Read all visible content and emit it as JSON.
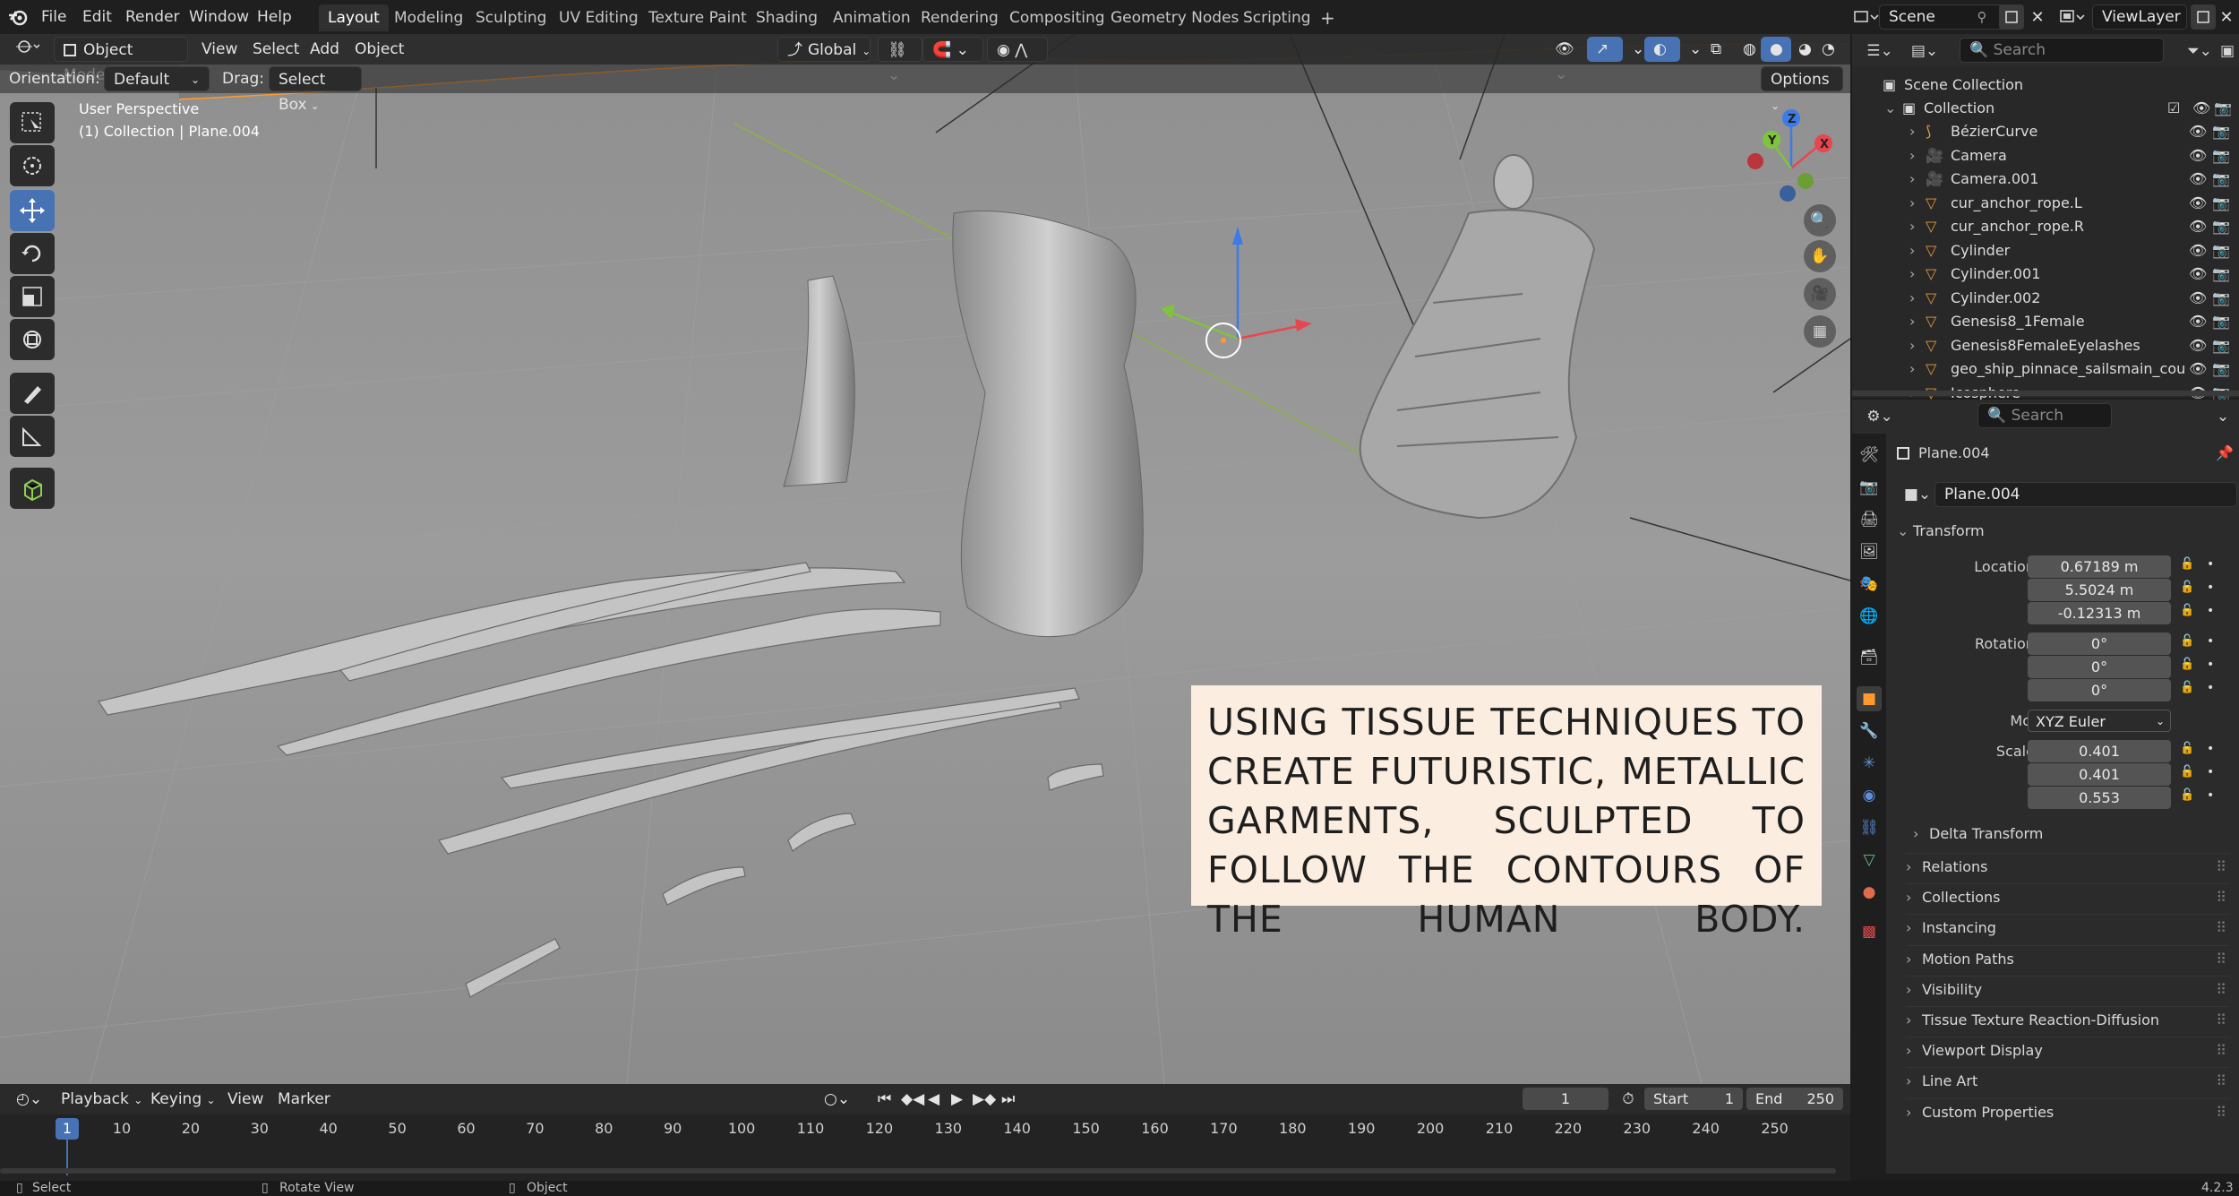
{
  "menu": [
    "File",
    "Edit",
    "Render",
    "Window",
    "Help"
  ],
  "workspaces": [
    "Layout",
    "Modeling",
    "Sculpting",
    "UV Editing",
    "Texture Paint",
    "Shading",
    "Animation",
    "Rendering",
    "Compositing",
    "Geometry Nodes",
    "Scripting"
  ],
  "active_workspace": "Layout",
  "scene": "Scene",
  "view_layer": "ViewLayer",
  "viewport": {
    "mode": "Object Mode",
    "menus": [
      "View",
      "Select",
      "Add",
      "Object"
    ],
    "transform_orientation": "Global",
    "orientation_label": "Orientation:",
    "orientation_value": "Default",
    "drag_label": "Drag:",
    "drag_value": "Select Box",
    "options": "Options",
    "view_name": "User Perspective",
    "view_context": "(1) Collection | Plane.004",
    "caption": "USING TISSUE TECHNIQUES TO CREATE FUTURISTIC, METALLIC GARMENTS, SCULPTED TO FOLLOW THE CONTOURS OF THE HUMAN BODY."
  },
  "outliner": {
    "search_placeholder": "Search",
    "root": "Scene Collection",
    "collection": "Collection",
    "items": [
      {
        "name": "BézierCurve",
        "type": "curve"
      },
      {
        "name": "Camera",
        "type": "camera"
      },
      {
        "name": "Camera.001",
        "type": "camera"
      },
      {
        "name": "cur_anchor_rope.L",
        "type": "mesh"
      },
      {
        "name": "cur_anchor_rope.R",
        "type": "mesh"
      },
      {
        "name": "Cylinder",
        "type": "mesh"
      },
      {
        "name": "Cylinder.001",
        "type": "mesh"
      },
      {
        "name": "Cylinder.002",
        "type": "mesh"
      },
      {
        "name": "Genesis8_1Female",
        "type": "mesh"
      },
      {
        "name": "Genesis8FemaleEyelashes",
        "type": "mesh"
      },
      {
        "name": "geo_ship_pinnace_sailsmain_cou",
        "type": "mesh"
      },
      {
        "name": "Icosphere",
        "type": "mesh"
      }
    ]
  },
  "properties": {
    "search_placeholder": "Search",
    "object_name": "Plane.004",
    "object_field": "Plane.004",
    "transform_label": "Transform",
    "location_label": "Location X",
    "location": [
      "0.67189 m",
      "5.5024 m",
      "-0.12313 m"
    ],
    "rotation_label": "Rotation X",
    "rotation": [
      "0°",
      "0°",
      "0°"
    ],
    "mode_label": "Mode",
    "mode_value": "XYZ Euler",
    "scale_label": "Scale X",
    "scale": [
      "0.401",
      "0.401",
      "0.553"
    ],
    "axis_y": "Y",
    "axis_z": "Z",
    "delta_transform": "Delta Transform",
    "panels": [
      "Relations",
      "Collections",
      "Instancing",
      "Motion Paths",
      "Visibility",
      "Tissue Texture Reaction-Diffusion",
      "Viewport Display",
      "Line Art",
      "Custom Properties"
    ]
  },
  "timeline": {
    "menus": [
      "Playback",
      "Keying",
      "View",
      "Marker"
    ],
    "current_frame": "1",
    "start_label": "Start",
    "start": "1",
    "end_label": "End",
    "end": "250",
    "ruler": [
      "1",
      "10",
      "20",
      "30",
      "40",
      "50",
      "60",
      "70",
      "80",
      "90",
      "100",
      "110",
      "120",
      "130",
      "140",
      "150",
      "160",
      "170",
      "180",
      "190",
      "200",
      "210",
      "220",
      "230",
      "240",
      "250"
    ]
  },
  "status": {
    "select": "Select",
    "rotate": "Rotate View",
    "object": "Object",
    "version": "4.2.3"
  },
  "colors": {
    "accent": "#4772b3",
    "header_bg": "#1f1f1f",
    "panel_bg": "#2b2b2b",
    "selection_orange": "#ff9a2e"
  }
}
